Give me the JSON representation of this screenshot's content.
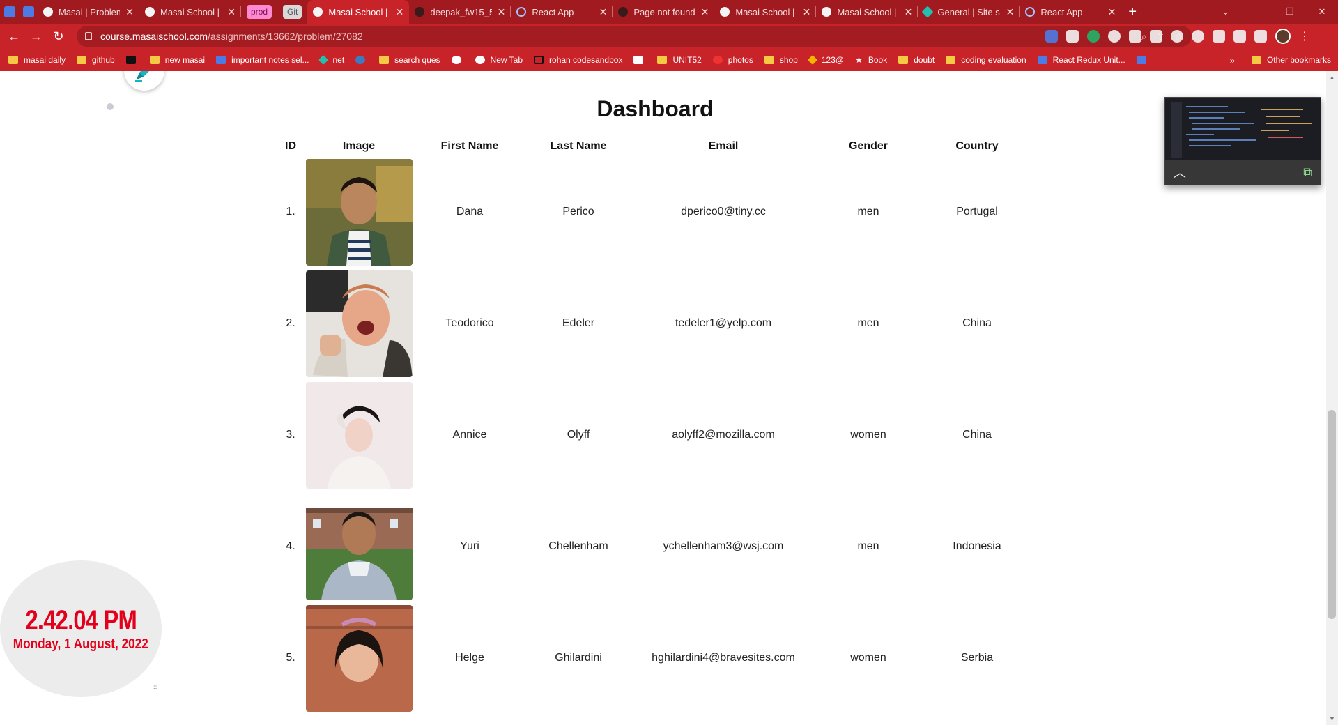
{
  "browser": {
    "tabs": [
      {
        "label": "Masai | Problem",
        "icon": "page-icon"
      },
      {
        "label": "Masai School |",
        "icon": "globe-icon"
      },
      {
        "label": "prod",
        "pill": true,
        "kind": "prod"
      },
      {
        "label": "Git",
        "pill": true,
        "kind": "git"
      },
      {
        "label": "Masai School |",
        "icon": "globe-icon",
        "active": true
      },
      {
        "label": "deepak_fw15_5",
        "icon": "github-icon"
      },
      {
        "label": "React App",
        "icon": "react-icon"
      },
      {
        "label": "Page not found",
        "icon": "github-icon"
      },
      {
        "label": "Masai School |",
        "icon": "globe-icon"
      },
      {
        "label": "Masai School |",
        "icon": "globe-icon"
      },
      {
        "label": "General | Site s",
        "icon": "netlify-icon"
      },
      {
        "label": "React App",
        "icon": "react-icon"
      }
    ],
    "url_host": "course.masaischool.com",
    "url_path": "/assignments/13662/problem/27082",
    "bookmarks": [
      {
        "label": "masai daily",
        "icon": "folder"
      },
      {
        "label": "github",
        "icon": "folder"
      },
      {
        "label": "",
        "icon": "m"
      },
      {
        "label": "new masai",
        "icon": "folder"
      },
      {
        "label": "important notes sel...",
        "icon": "doc"
      },
      {
        "label": "net",
        "icon": "gem"
      },
      {
        "label": "",
        "icon": "py"
      },
      {
        "label": "search ques",
        "icon": "folder"
      },
      {
        "label": "",
        "icon": "circ"
      },
      {
        "label": "New Tab",
        "icon": "circ"
      },
      {
        "label": "rohan codesandbox",
        "icon": "box"
      },
      {
        "label": "",
        "icon": "gmail"
      },
      {
        "label": "UNIT52",
        "icon": "folder"
      },
      {
        "label": "photos",
        "icon": "pin"
      },
      {
        "label": "shop",
        "icon": "folder"
      },
      {
        "label": "123@",
        "icon": "drive"
      },
      {
        "label": "Book",
        "icon": "star"
      },
      {
        "label": "doubt",
        "icon": "folder"
      },
      {
        "label": "coding evaluation",
        "icon": "folder"
      },
      {
        "label": "React Redux Unit...",
        "icon": "doc"
      },
      {
        "label": "",
        "icon": "doc"
      }
    ],
    "bookmarks_more": "»",
    "other_bookmarks": "Other bookmarks"
  },
  "page": {
    "title": "Dashboard",
    "columns": [
      "ID",
      "Image",
      "First Name",
      "Last Name",
      "Email",
      "Gender",
      "Country"
    ],
    "rows": [
      {
        "id": "1.",
        "first": "Dana",
        "last": "Perico",
        "email": "dperico0@tiny.cc",
        "gender": "men",
        "country": "Portugal"
      },
      {
        "id": "2.",
        "first": "Teodorico",
        "last": "Edeler",
        "email": "tedeler1@yelp.com",
        "gender": "men",
        "country": "China"
      },
      {
        "id": "3.",
        "first": "Annice",
        "last": "Olyff",
        "email": "aolyff2@mozilla.com",
        "gender": "women",
        "country": "China"
      },
      {
        "id": "4.",
        "first": "Yuri",
        "last": "Chellenham",
        "email": "ychellenham3@wsj.com",
        "gender": "men",
        "country": "Indonesia"
      },
      {
        "id": "5.",
        "first": "Helge",
        "last": "Ghilardini",
        "email": "hghilardini4@bravesites.com",
        "gender": "women",
        "country": "Serbia"
      }
    ]
  },
  "clock": {
    "time": "2.42.04 PM",
    "date": "Monday, 1 August, 2022",
    "color": "#e3001b"
  },
  "colors": {
    "chrome": "#c9232a",
    "chrome_dark": "#a11a1f"
  }
}
